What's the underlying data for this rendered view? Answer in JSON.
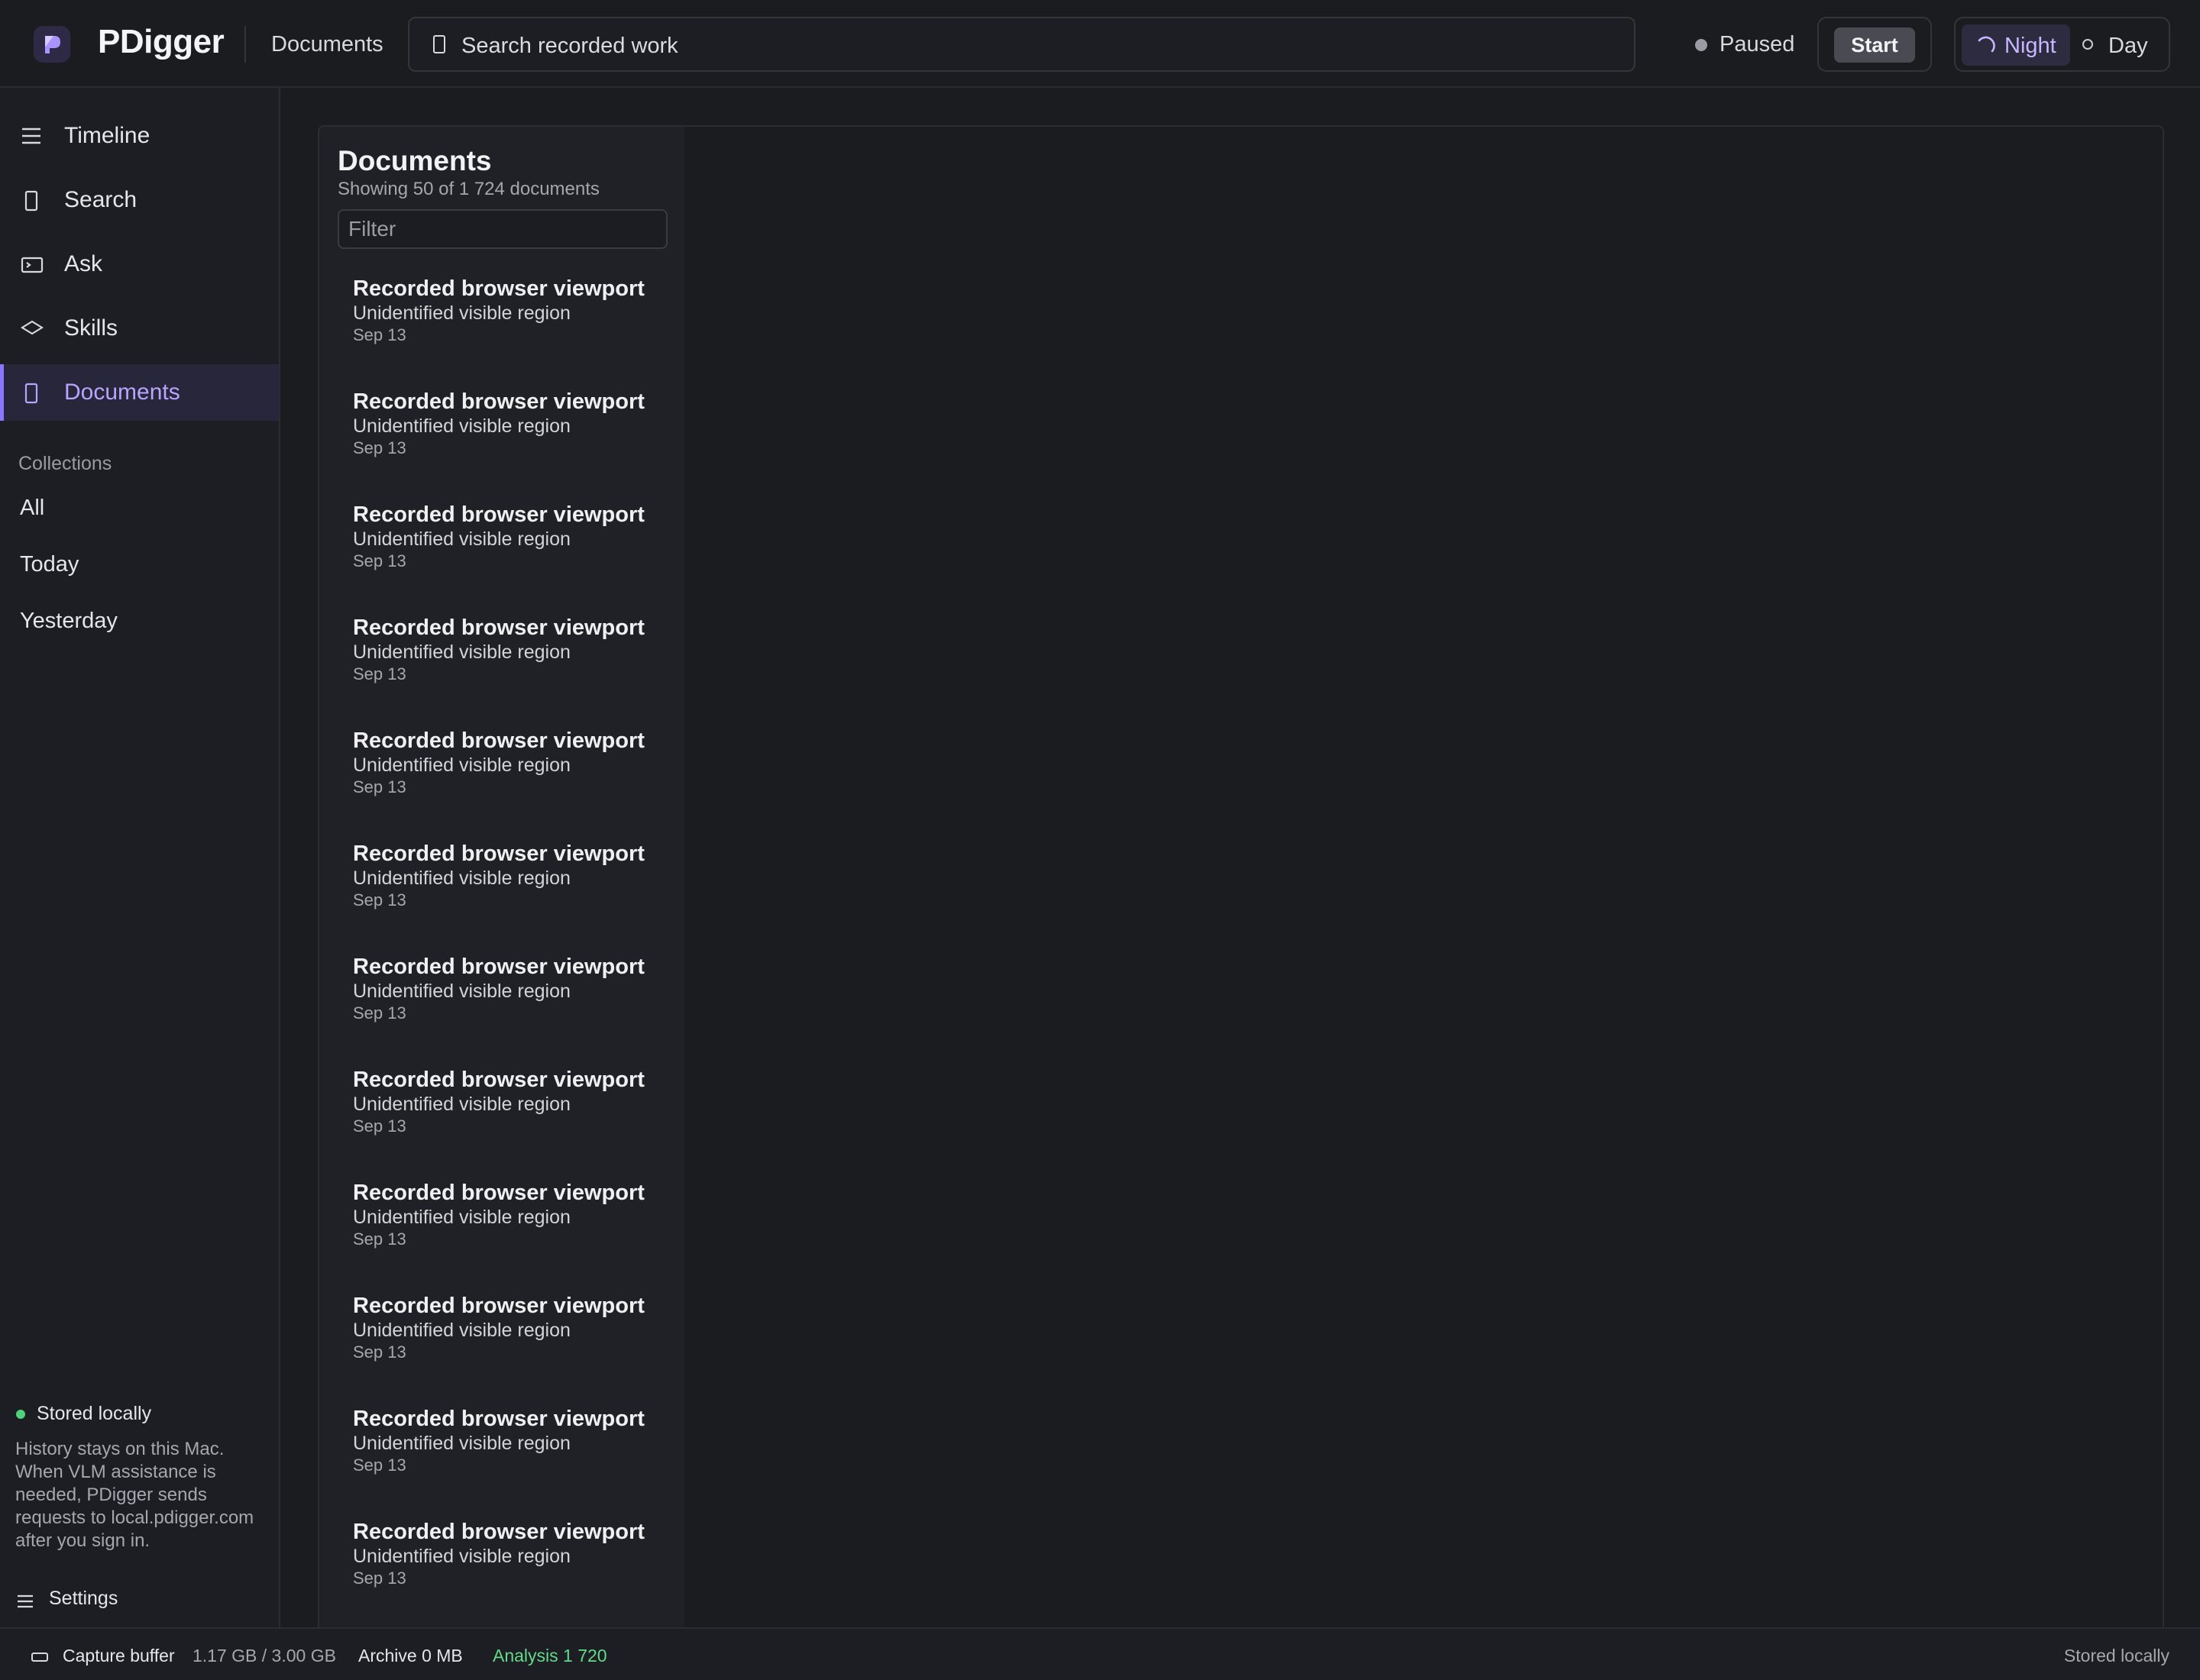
{
  "app": {
    "title": "PDigger",
    "breadcrumb": "Documents"
  },
  "search": {
    "placeholder": "Search recorded work"
  },
  "status": {
    "text": "Paused"
  },
  "controls": {
    "start_label": "Start",
    "theme_night": "Night",
    "theme_day": "Day"
  },
  "sidebar": {
    "nav": [
      {
        "label": "Timeline",
        "icon": "menu-icon"
      },
      {
        "label": "Search",
        "icon": "document-icon"
      },
      {
        "label": "Ask",
        "icon": "terminal-icon"
      },
      {
        "label": "Skills",
        "icon": "diamond-icon"
      },
      {
        "label": "Documents",
        "icon": "document-icon",
        "active": true
      }
    ],
    "collections_title": "Collections",
    "collections": [
      "All",
      "Today",
      "Yesterday"
    ],
    "stored_label": "Stored locally",
    "stored_desc": "History stays on this Mac. When VLM assistance is needed, PDigger sends requests to local.pdigger.com after you sign in.",
    "settings_label": "Settings"
  },
  "documents": {
    "title": "Documents",
    "count": "Showing 50 of 1 724 documents",
    "filter_placeholder": "Filter",
    "items": [
      {
        "title": "Recorded browser viewport",
        "subtitle": "Unidentified visible region",
        "date": "Sep 13"
      },
      {
        "title": "Recorded browser viewport",
        "subtitle": "Unidentified visible region",
        "date": "Sep 13"
      },
      {
        "title": "Recorded browser viewport",
        "subtitle": "Unidentified visible region",
        "date": "Sep 13"
      },
      {
        "title": "Recorded browser viewport",
        "subtitle": "Unidentified visible region",
        "date": "Sep 13"
      },
      {
        "title": "Recorded browser viewport",
        "subtitle": "Unidentified visible region",
        "date": "Sep 13"
      },
      {
        "title": "Recorded browser viewport",
        "subtitle": "Unidentified visible region",
        "date": "Sep 13"
      },
      {
        "title": "Recorded browser viewport",
        "subtitle": "Unidentified visible region",
        "date": "Sep 13"
      },
      {
        "title": "Recorded browser viewport",
        "subtitle": "Unidentified visible region",
        "date": "Sep 13"
      },
      {
        "title": "Recorded browser viewport",
        "subtitle": "Unidentified visible region",
        "date": "Sep 13"
      },
      {
        "title": "Recorded browser viewport",
        "subtitle": "Unidentified visible region",
        "date": "Sep 13"
      },
      {
        "title": "Recorded browser viewport",
        "subtitle": "Unidentified visible region",
        "date": "Sep 13"
      },
      {
        "title": "Recorded browser viewport",
        "subtitle": "Unidentified visible region",
        "date": "Sep 13"
      }
    ]
  },
  "footer": {
    "capture_label": "Capture buffer",
    "capture_value": "1.17 GB / 3.00 GB",
    "archive": "Archive 0 MB",
    "analysis": "Analysis 1 720",
    "stored": "Stored locally"
  },
  "colors": {
    "accent": "#8b74ff",
    "accent_text": "#b9a4ff",
    "success": "#4ed37a",
    "background": "#1b1c20"
  }
}
